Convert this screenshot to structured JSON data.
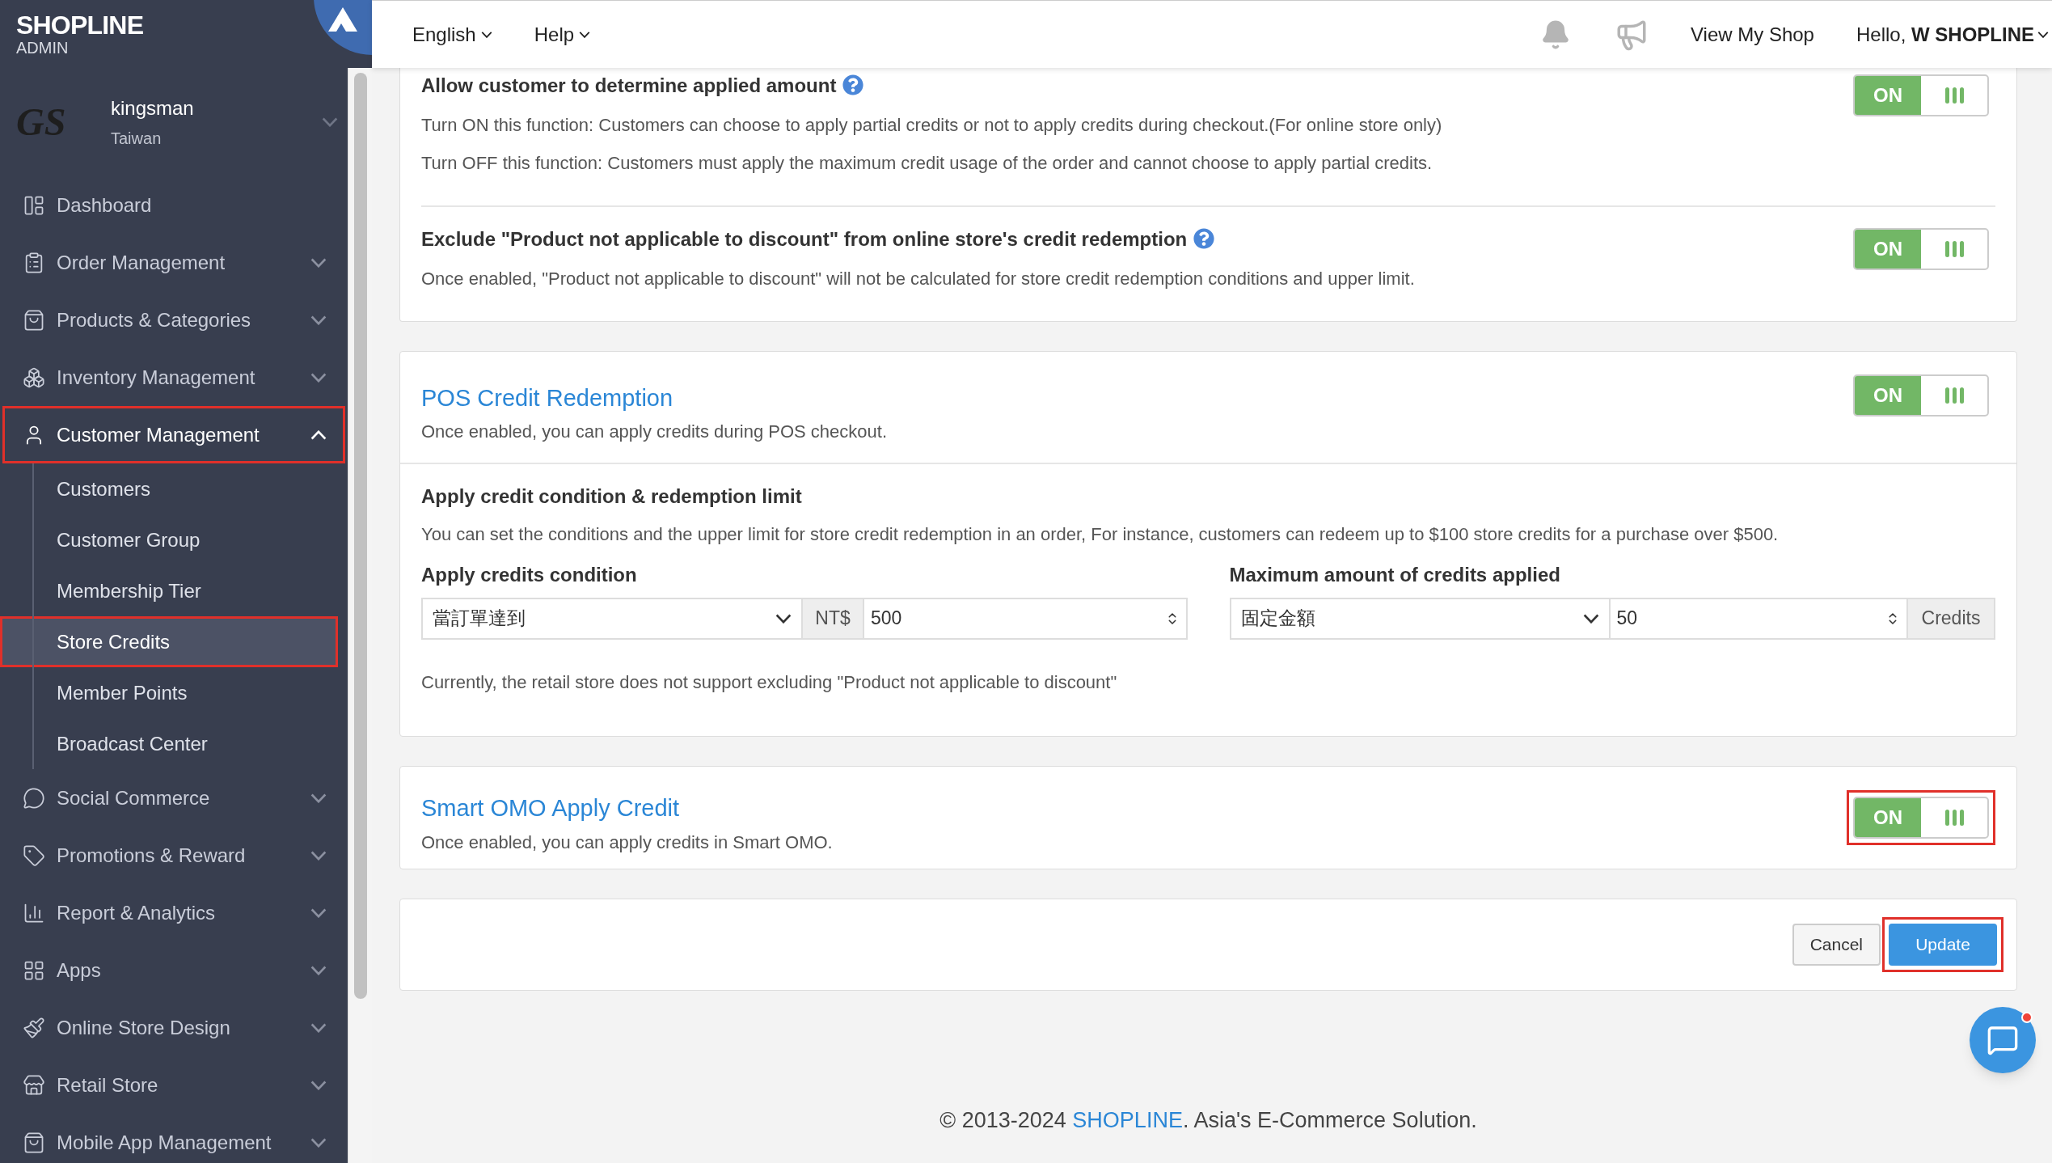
{
  "brand": {
    "name": "SHOPLINE",
    "sub": "ADMIN"
  },
  "account": {
    "logo_text": "GS",
    "name": "kingsman",
    "region": "Taiwan"
  },
  "sidebar": {
    "items": [
      {
        "label": "Dashboard",
        "expandable": false,
        "expanded": false,
        "highlighted": false
      },
      {
        "label": "Order Management",
        "expandable": true,
        "expanded": false,
        "highlighted": false
      },
      {
        "label": "Products & Categories",
        "expandable": true,
        "expanded": false,
        "highlighted": false
      },
      {
        "label": "Inventory Management",
        "expandable": true,
        "expanded": false,
        "highlighted": false
      },
      {
        "label": "Customer Management",
        "expandable": true,
        "expanded": true,
        "highlighted": true,
        "children": [
          {
            "label": "Customers",
            "selected": false,
            "highlighted": false
          },
          {
            "label": "Customer Group",
            "selected": false,
            "highlighted": false
          },
          {
            "label": "Membership Tier",
            "selected": false,
            "highlighted": false
          },
          {
            "label": "Store Credits",
            "selected": true,
            "highlighted": true
          },
          {
            "label": "Member Points",
            "selected": false,
            "highlighted": false
          },
          {
            "label": "Broadcast Center",
            "selected": false,
            "highlighted": false
          }
        ]
      },
      {
        "label": "Social Commerce",
        "expandable": true,
        "expanded": false,
        "highlighted": false
      },
      {
        "label": "Promotions & Reward",
        "expandable": true,
        "expanded": false,
        "highlighted": false
      },
      {
        "label": "Report & Analytics",
        "expandable": true,
        "expanded": false,
        "highlighted": false
      },
      {
        "label": "Apps",
        "expandable": true,
        "expanded": false,
        "highlighted": false
      },
      {
        "label": "Online Store Design",
        "expandable": true,
        "expanded": false,
        "highlighted": false
      },
      {
        "label": "Retail Store",
        "expandable": true,
        "expanded": false,
        "highlighted": false
      },
      {
        "label": "Mobile App Management",
        "expandable": true,
        "expanded": false,
        "highlighted": false
      }
    ]
  },
  "topbar": {
    "language": "English",
    "help": "Help",
    "view_shop": "View My Shop",
    "greeting": "Hello, **W SHOPLINE**"
  },
  "online_settings": [
    {
      "title": "Allow customer to determine applied amount",
      "help": true,
      "lines": [
        "Turn ON this function: Customers can choose to apply partial credits or not to apply credits during checkout.(For online store only)",
        "Turn OFF this function: Customers must apply the maximum credit usage of the order and cannot choose to apply partial credits."
      ],
      "toggle": {
        "label": "ON",
        "on": true
      }
    },
    {
      "title": "Exclude \"Product not applicable to discount\" from online store's credit redemption",
      "help": true,
      "lines": [
        "Once enabled, \"Product not applicable to discount\" will not be calculated for store credit redemption conditions and upper limit."
      ],
      "toggle": {
        "label": "ON",
        "on": true
      }
    }
  ],
  "pos": {
    "title": "POS Credit Redemption",
    "description": "Once enabled, you can apply credits during POS checkout.",
    "toggle": {
      "label": "ON",
      "on": true
    },
    "limit": {
      "heading": "Apply credit condition & redemption limit",
      "description": "You can set the conditions and the upper limit for store credit redemption in an order, For instance, customers can redeem up to $100 store credits for a purchase over $500.",
      "condition": {
        "label": "Apply credits condition",
        "select": "當訂單達到",
        "prefix": "NT$",
        "value": "500"
      },
      "maximum": {
        "label": "Maximum amount of credits applied",
        "select": "固定金額",
        "value": "50",
        "suffix": "Credits"
      },
      "note": "Currently, the retail store does not support excluding \"Product not applicable to discount\""
    }
  },
  "smart_omo": {
    "title": "Smart OMO Apply Credit",
    "description": "Once enabled, you can apply credits in Smart OMO.",
    "toggle": {
      "label": "ON",
      "on": true,
      "highlighted": true
    }
  },
  "actions": {
    "cancel": {
      "label": "Cancel"
    },
    "update": {
      "label": "Update",
      "highlighted": true
    }
  },
  "footer": {
    "before": "© 2013-2024 ",
    "link": "SHOPLINE",
    "after": ". Asia's E-Commerce Solution."
  },
  "chat": {
    "unread": true
  }
}
